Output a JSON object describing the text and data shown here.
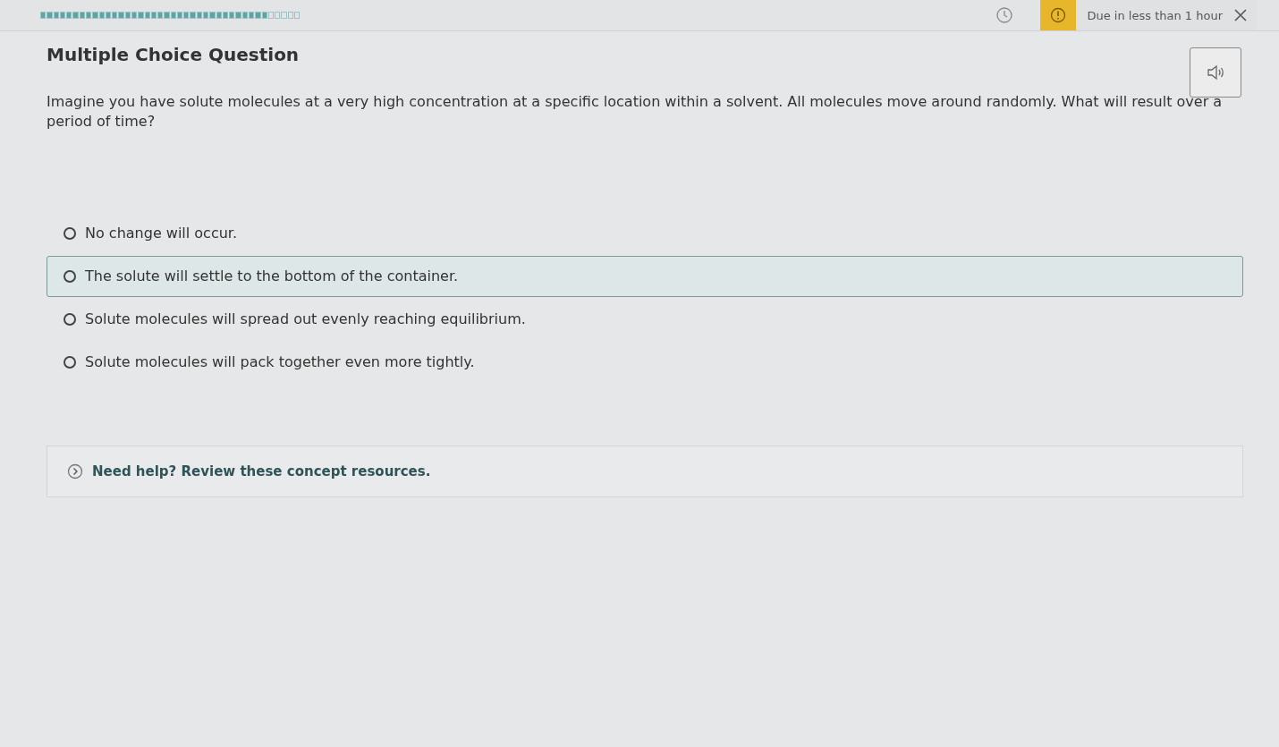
{
  "header": {
    "progress": {
      "level": 0.88
    },
    "due": "Due in less than 1 hour"
  },
  "question": {
    "type": "Multiple Choice Question",
    "prompt": "Imagine you have solute molecules at a very high concentration at a specific location within a solvent. All molecules move around randomly. What will result over a period of time?",
    "options": [
      {
        "text": "No change will occur.",
        "selected": false,
        "hovered": false
      },
      {
        "text": "The solute will settle to the bottom of the container.",
        "selected": false,
        "hovered": true
      },
      {
        "text": "Solute molecules will spread out evenly reaching equilibrium.",
        "selected": false,
        "hovered": false
      },
      {
        "text": "Solute molecules will pack together even more tightly.",
        "selected": false,
        "hovered": false
      }
    ]
  },
  "help": {
    "text": "Need help? Review these concept resources.",
    "expanded": false
  }
}
